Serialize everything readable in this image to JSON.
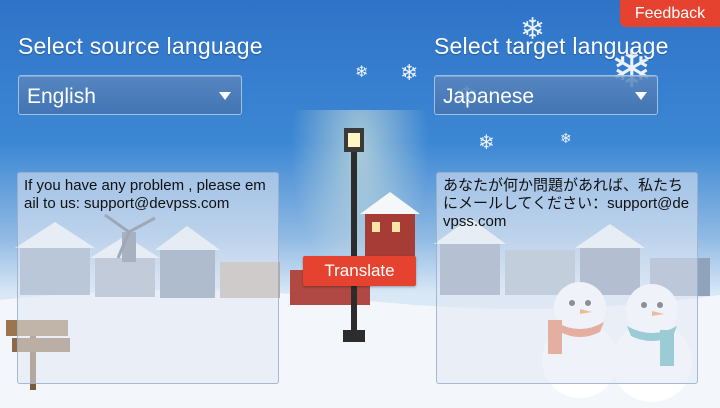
{
  "source": {
    "label": "Select source language",
    "selected": "English",
    "text": "If you have any problem , please  email to us: support@devpss.com"
  },
  "target": {
    "label": "Select target language",
    "selected": "Japanese",
    "text": "あなたが何か問題があれば、私たちにメールしてください：support@devpss.com"
  },
  "buttons": {
    "translate": "Translate",
    "feedback": "Feedback"
  },
  "colors": {
    "accent_button": "#e5432f",
    "sky_top": "#2f73c8"
  },
  "icons": [
    "dropdown-arrow-icon",
    "snowflake-icon"
  ]
}
